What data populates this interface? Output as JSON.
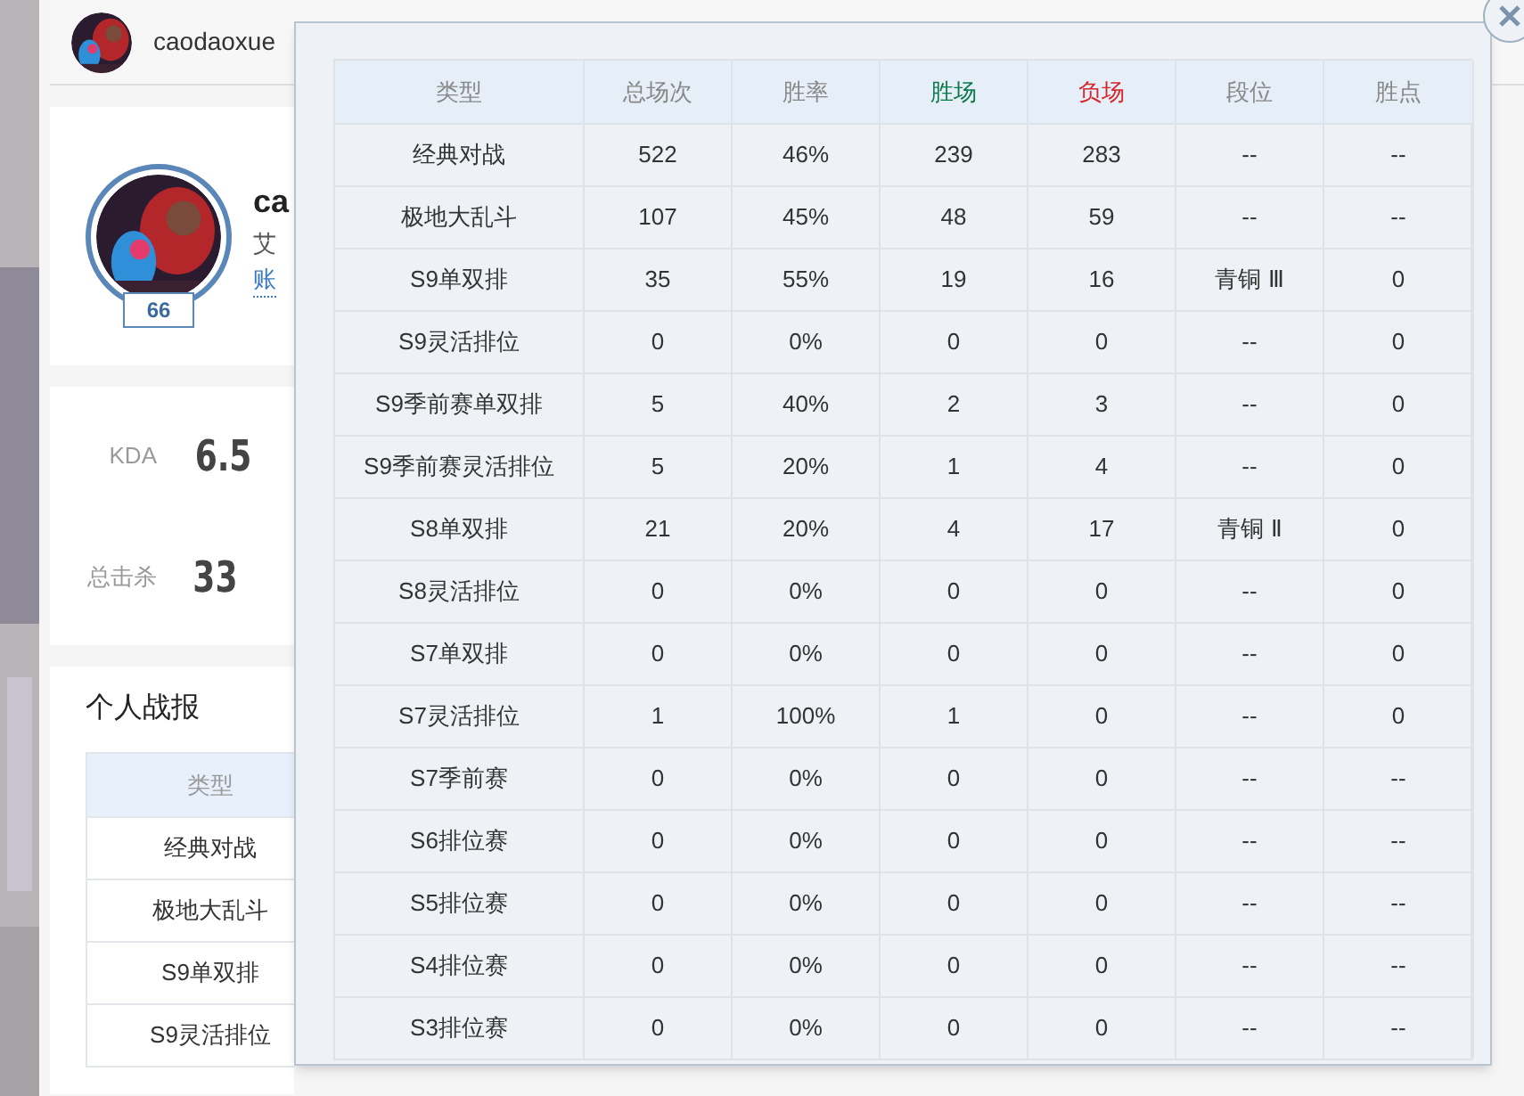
{
  "header": {
    "username": "caodaoxue"
  },
  "profile": {
    "level": "66",
    "name": "ca",
    "line_1": "艾",
    "link": "账"
  },
  "stats": [
    {
      "label": "KDA",
      "value": "6.5"
    },
    {
      "label": "总击杀",
      "value": "33"
    }
  ],
  "report": {
    "title": "个人战报",
    "column": "类型",
    "rows": [
      "经典对战",
      "极地大乱斗",
      "S9单双排",
      "S9灵活排位"
    ]
  },
  "popup": {
    "columns": [
      {
        "label": "类型",
        "kind": "normal"
      },
      {
        "label": "总场次",
        "kind": "normal"
      },
      {
        "label": "胜率",
        "kind": "normal"
      },
      {
        "label": "胜场",
        "kind": "win"
      },
      {
        "label": "负场",
        "kind": "loss"
      },
      {
        "label": "段位",
        "kind": "normal"
      },
      {
        "label": "胜点",
        "kind": "normal"
      }
    ],
    "rows": [
      [
        "经典对战",
        "522",
        "46%",
        "239",
        "283",
        "--",
        "--"
      ],
      [
        "极地大乱斗",
        "107",
        "45%",
        "48",
        "59",
        "--",
        "--"
      ],
      [
        "S9单双排",
        "35",
        "55%",
        "19",
        "16",
        "青铜 Ⅲ",
        "0"
      ],
      [
        "S9灵活排位",
        "0",
        "0%",
        "0",
        "0",
        "--",
        "0"
      ],
      [
        "S9季前赛单双排",
        "5",
        "40%",
        "2",
        "3",
        "--",
        "0"
      ],
      [
        "S9季前赛灵活排位",
        "5",
        "20%",
        "1",
        "4",
        "--",
        "0"
      ],
      [
        "S8单双排",
        "21",
        "20%",
        "4",
        "17",
        "青铜 Ⅱ",
        "0"
      ],
      [
        "S8灵活排位",
        "0",
        "0%",
        "0",
        "0",
        "--",
        "0"
      ],
      [
        "S7单双排",
        "0",
        "0%",
        "0",
        "0",
        "--",
        "0"
      ],
      [
        "S7灵活排位",
        "1",
        "100%",
        "1",
        "0",
        "--",
        "0"
      ],
      [
        "S7季前赛",
        "0",
        "0%",
        "0",
        "0",
        "--",
        "--"
      ],
      [
        "S6排位赛",
        "0",
        "0%",
        "0",
        "0",
        "--",
        "--"
      ],
      [
        "S5排位赛",
        "0",
        "0%",
        "0",
        "0",
        "--",
        "--"
      ],
      [
        "S4排位赛",
        "0",
        "0%",
        "0",
        "0",
        "--",
        "--"
      ],
      [
        "S3排位赛",
        "0",
        "0%",
        "0",
        "0",
        "--",
        "--"
      ]
    ]
  }
}
